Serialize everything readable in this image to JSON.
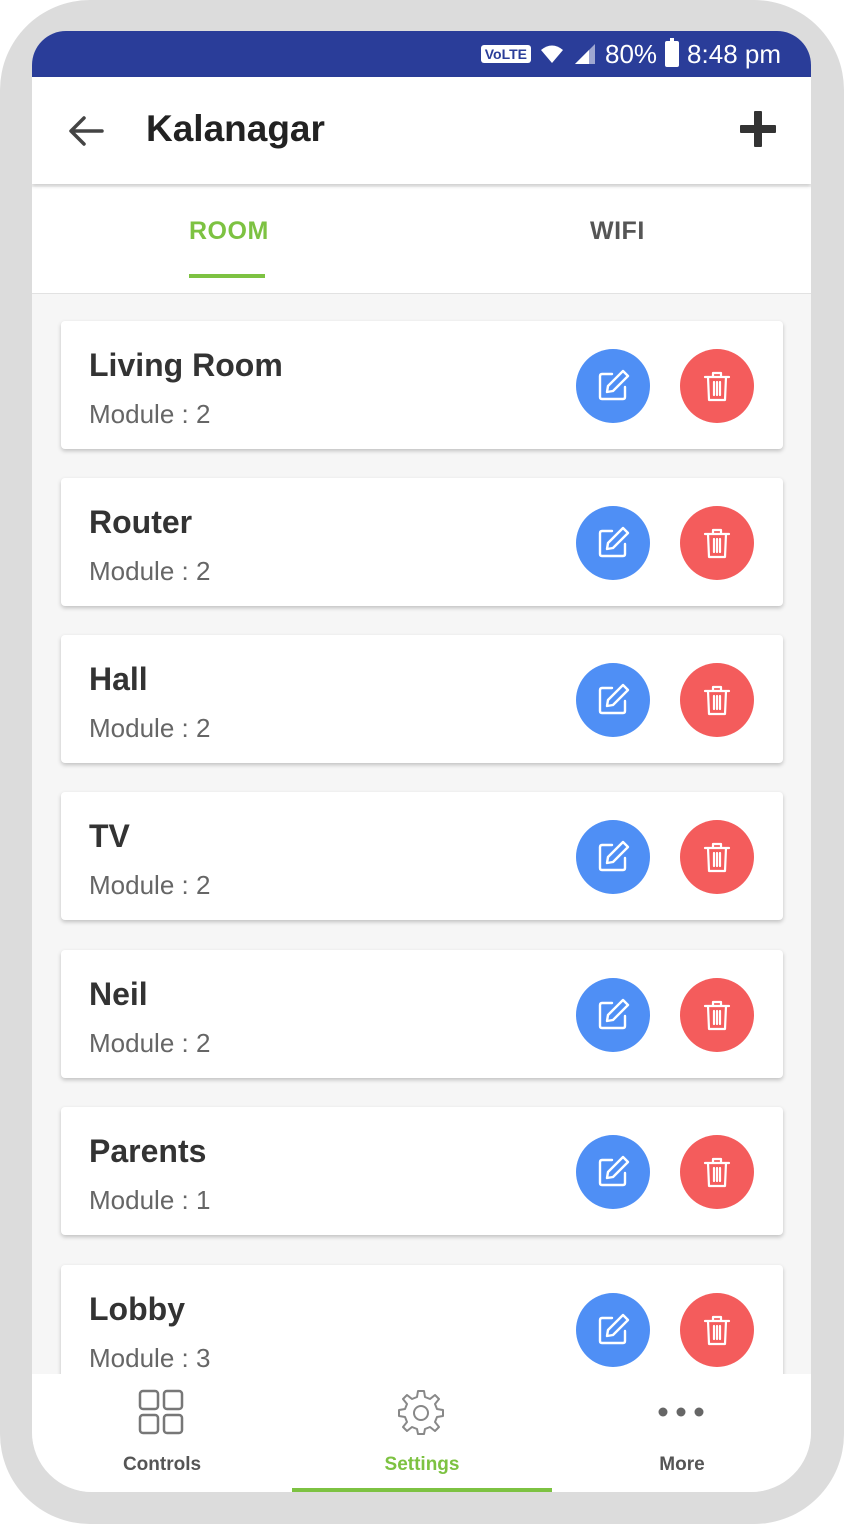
{
  "status_bar": {
    "volte": "VoLTE",
    "battery": "80%",
    "time": "8:48 pm"
  },
  "app_bar": {
    "title": "Kalanagar",
    "back_icon": "arrow-left-icon",
    "add_icon": "plus-icon"
  },
  "tabs": [
    {
      "label": "ROOM",
      "active": true
    },
    {
      "label": "WIFI",
      "active": false
    }
  ],
  "rooms": [
    {
      "name": "Living Room",
      "module": "Module : 2"
    },
    {
      "name": "Router",
      "module": "Module : 2"
    },
    {
      "name": "Hall",
      "module": "Module : 2"
    },
    {
      "name": "TV",
      "module": "Module : 2"
    },
    {
      "name": "Neil",
      "module": "Module : 2"
    },
    {
      "name": "Parents",
      "module": "Module : 1"
    },
    {
      "name": "Lobby",
      "module": "Module : 3"
    }
  ],
  "bottom_nav": [
    {
      "label": "Controls",
      "icon": "grid-icon",
      "active": false
    },
    {
      "label": "Settings",
      "icon": "gear-icon",
      "active": true
    },
    {
      "label": "More",
      "icon": "more-dots-icon",
      "active": false
    }
  ],
  "colors": {
    "status_bar": "#2a3d99",
    "accent": "#7dc242",
    "edit": "#4f8ff5",
    "delete": "#f45c5c"
  }
}
